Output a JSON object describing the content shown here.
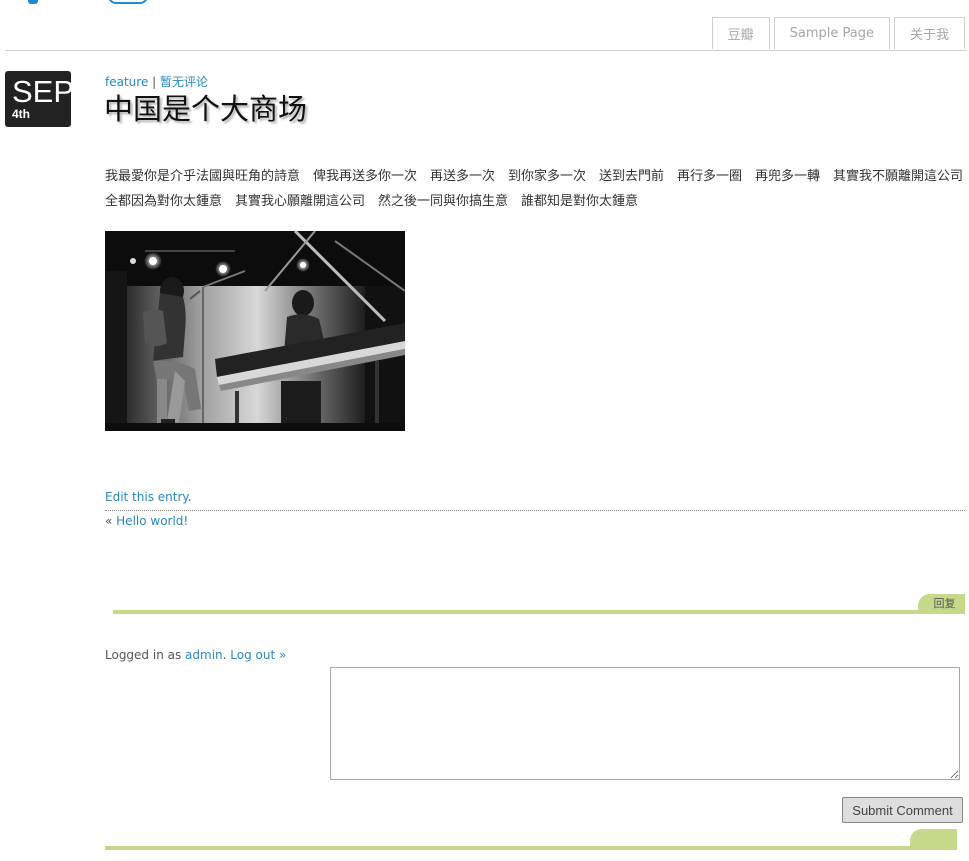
{
  "nav": {
    "items": [
      {
        "label": "豆瓣"
      },
      {
        "label": "Sample Page"
      },
      {
        "label": "关于我"
      }
    ]
  },
  "post": {
    "date_month": "SEP",
    "date_day": "4th",
    "category": "feature",
    "meta_separator": " | ",
    "comments_link": "暂无评论",
    "title": "中国是个大商场",
    "body": "我最愛你是介乎法國與旺角的詩意　俾我再送多你一次　再送多一次　到你家多一次　送到去門前　再行多一圈　再兜多一轉　其實我不願離開這公司　全都因為對你太鍾意　其實我心願離開這公司　然之後一同與你搞生意　誰都知是對你太鍾意",
    "edit_link": "Edit this entry",
    "edit_suffix": ".",
    "prev_prefix": "« ",
    "prev_link": "Hello world!"
  },
  "comments": {
    "reply_tab": "回复",
    "logged_in_prefix": "Logged in as ",
    "user": "admin",
    "separator": ". ",
    "logout": "Log out »",
    "textarea_value": "",
    "submit_label": "Submit Comment"
  },
  "colors": {
    "accent_link": "#2a88c4",
    "bar_green": "#c5d98a",
    "date_badge": "#222222"
  }
}
